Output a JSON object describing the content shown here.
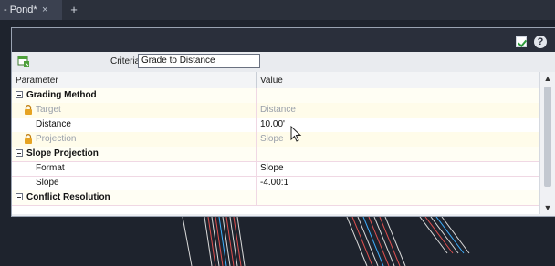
{
  "tabs": {
    "active_label": "- Pond*",
    "close_glyph": "×",
    "add_glyph": "+"
  },
  "palette": {
    "help_glyph": "?",
    "criteria_label": "Criteria:",
    "criteria_value": "Grade to Distance",
    "columns": {
      "parameter": "Parameter",
      "value": "Value"
    },
    "rows": [
      {
        "label": "Grading Method",
        "value": "",
        "kind": "group"
      },
      {
        "label": "Target",
        "value": "Distance",
        "kind": "locked"
      },
      {
        "label": "Distance",
        "value": "10.00'",
        "kind": "normal"
      },
      {
        "label": "Projection",
        "value": "Slope",
        "kind": "locked"
      },
      {
        "label": "Slope Projection",
        "value": "",
        "kind": "group"
      },
      {
        "label": "Format",
        "value": "Slope",
        "kind": "normal"
      },
      {
        "label": "Slope",
        "value": "-4.00:1",
        "kind": "normal"
      },
      {
        "label": "Conflict Resolution",
        "value": "",
        "kind": "group"
      }
    ]
  },
  "icons": {
    "check": "checkmark-icon",
    "help": "help-icon",
    "lock": "lock-icon",
    "grid": "parameter-grid-icon",
    "cursor": "mouse-pointer-icon"
  },
  "colors": {
    "canvas": "#1e232d",
    "lock": "#e0a020",
    "check": "#2e9a3b",
    "row_divider": "#f0d8e4"
  }
}
